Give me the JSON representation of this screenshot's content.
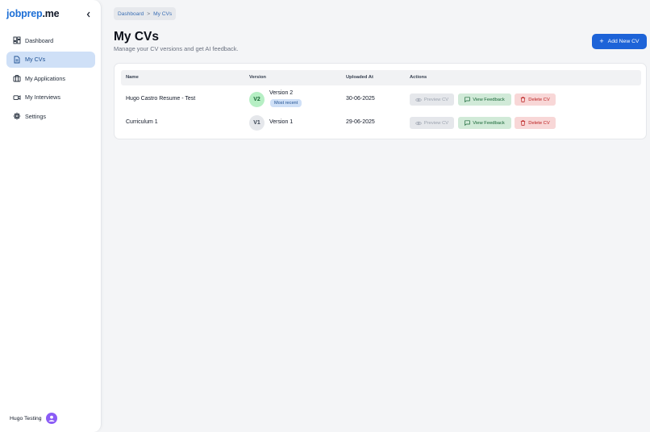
{
  "brand": {
    "part1": "jobprep",
    "part2": ".me"
  },
  "sidebar": {
    "items": [
      {
        "label": "Dashboard",
        "icon": "dashboard-icon",
        "active": false
      },
      {
        "label": "My CVs",
        "icon": "document-icon",
        "active": true
      },
      {
        "label": "My Applications",
        "icon": "briefcase-icon",
        "active": false
      },
      {
        "label": "My Interviews",
        "icon": "video-icon",
        "active": false
      },
      {
        "label": "Settings",
        "icon": "gear-icon",
        "active": false
      }
    ],
    "user_name": "Hugo Testing"
  },
  "breadcrumb": {
    "root": "Dashboard",
    "separator": ">",
    "current": "My CVs"
  },
  "page": {
    "title": "My CVs",
    "subtitle": "Manage your CV versions and get AI feedback.",
    "add_button": "Add New CV"
  },
  "table": {
    "headers": {
      "name": "Name",
      "version": "Version",
      "uploaded": "Uploaded At",
      "actions": "Actions"
    },
    "rows": [
      {
        "name": "Hugo Castro Resume - Test",
        "badge": "V2",
        "version": "Version 2",
        "tag": "Most recent",
        "uploaded": "30-06-2025"
      },
      {
        "name": "Curriculum 1",
        "badge": "V1",
        "version": "Version 1",
        "tag": "",
        "uploaded": "29-06-2025"
      }
    ],
    "actions": {
      "preview": "Preview CV",
      "feedback": "View Feedback",
      "delete": "Delete CV"
    }
  },
  "colors": {
    "accent": "#1d63d8",
    "active_nav": "#cfe0f7",
    "feedback_bg": "#d1ead8",
    "delete_bg": "#f8d7d7",
    "avatar": "#8b5cf6"
  }
}
